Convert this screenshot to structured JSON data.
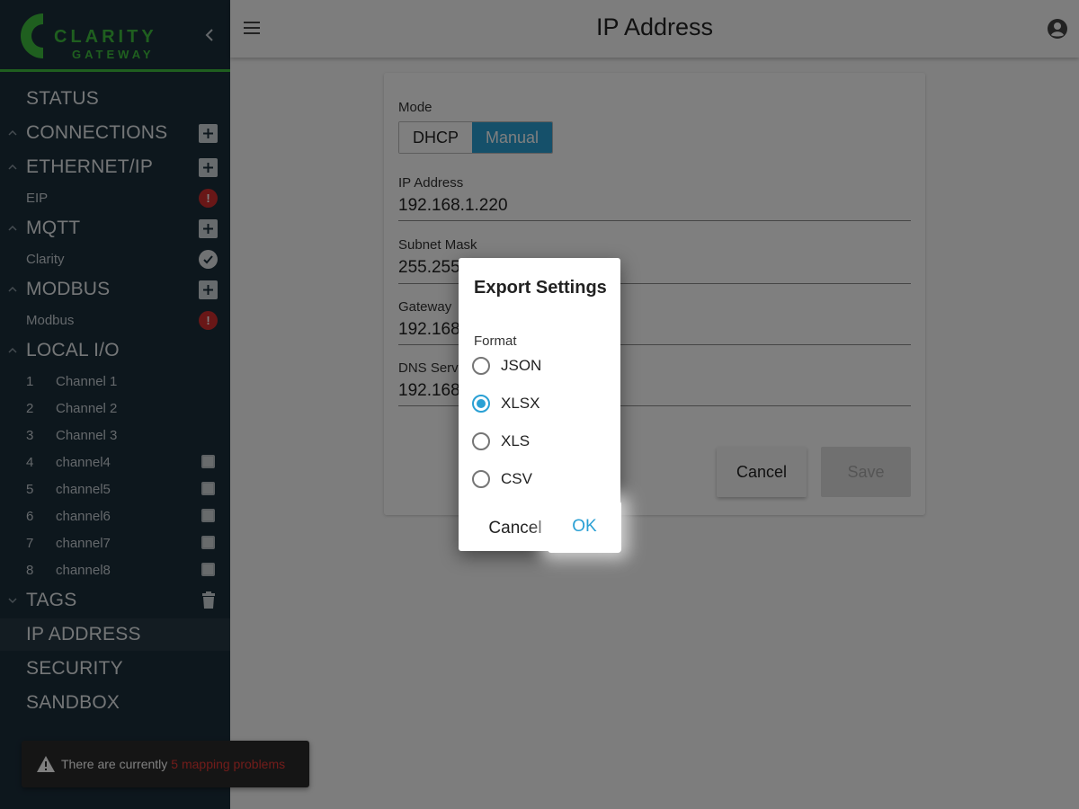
{
  "brand": {
    "word1": "CLARITY",
    "word2": "GATEWAY",
    "accent": "#3fbf3f"
  },
  "sidebar": {
    "status": "STATUS",
    "connections": "CONNECTIONS",
    "ethernet_ip": "ETHERNET/IP",
    "eip": "EIP",
    "mqtt": "MQTT",
    "clarity": "Clarity",
    "modbus": "MODBUS",
    "modbus_item": "Modbus",
    "local_io": "LOCAL I/O",
    "channels": [
      {
        "num": "1",
        "name": "Channel 1"
      },
      {
        "num": "2",
        "name": "Channel 2"
      },
      {
        "num": "3",
        "name": "Channel 3"
      },
      {
        "num": "4",
        "name": "channel4"
      },
      {
        "num": "5",
        "name": "channel5"
      },
      {
        "num": "6",
        "name": "channel6"
      },
      {
        "num": "7",
        "name": "channel7"
      },
      {
        "num": "8",
        "name": "channel8"
      }
    ],
    "tags": "TAGS",
    "ip_address": "IP ADDRESS",
    "security": "SECURITY",
    "sandbox": "SANDBOX",
    "error_mark": "!"
  },
  "header": {
    "title": "IP Address"
  },
  "form": {
    "mode_label": "Mode",
    "mode_dhcp": "DHCP",
    "mode_manual": "Manual",
    "ip_label": "IP Address",
    "ip_value": "192.168.1.220",
    "subnet_label": "Subnet Mask",
    "subnet_value": "255.255",
    "gateway_label": "Gateway",
    "gateway_value": "192.168",
    "dns_label": "DNS Serv",
    "dns_value": "192.168",
    "cancel": "Cancel",
    "save": "Save"
  },
  "snackbar": {
    "text": "There are currently",
    "highlight": "5 mapping problems"
  },
  "dialog": {
    "title": "Export Settings",
    "format_label": "Format",
    "options": [
      "JSON",
      "XLSX",
      "XLS",
      "CSV"
    ],
    "selected": "XLSX",
    "cancel": "Cancel",
    "ok": "OK"
  },
  "colors": {
    "sidebar_bg": "#1b2e3b",
    "primary": "#2aa0d4",
    "error": "#d32f2f"
  }
}
